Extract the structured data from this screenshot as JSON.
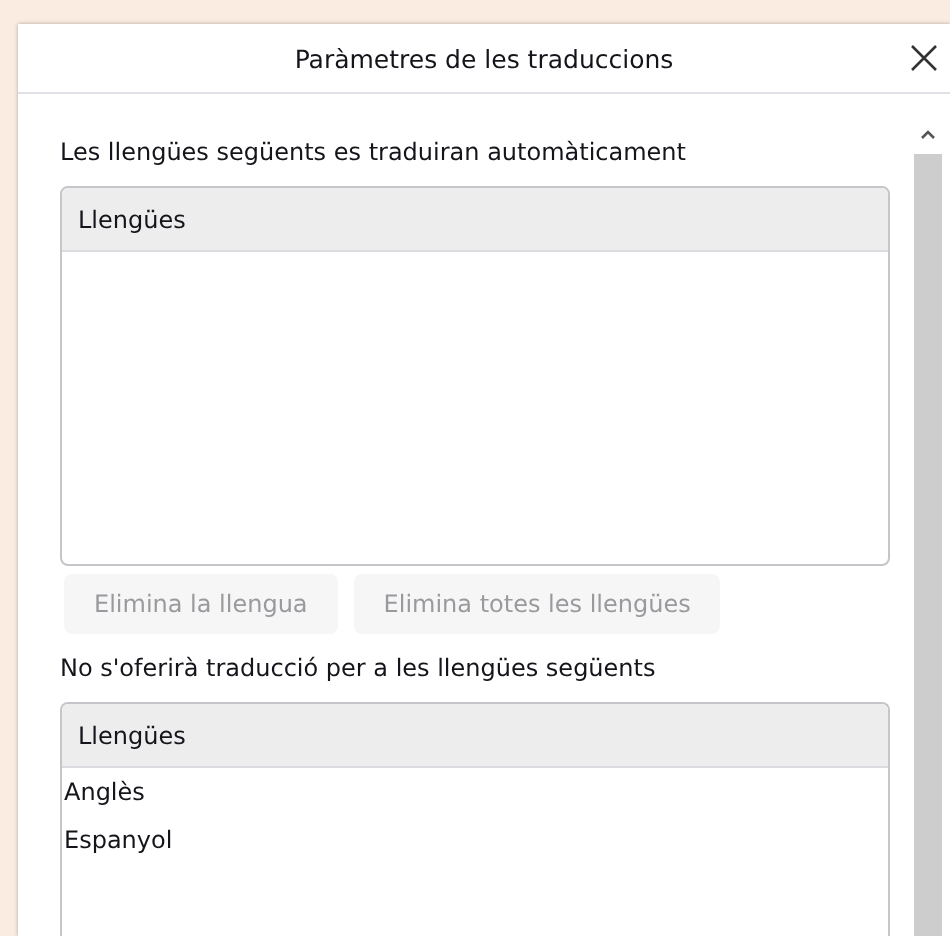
{
  "dialog": {
    "title": "Paràmetres de les traduccions"
  },
  "always_translate": {
    "label": "Les llengües següents es traduiran automàticament",
    "column": "Llengües"
  },
  "buttons": [
    {
      "label": "Elimina la llengua",
      "disabled": true
    },
    {
      "label": "Elimina totes les llengües",
      "disabled": true
    }
  ],
  "never_translate": {
    "label": "No s'oferirà traducció per a les llengües següents",
    "column": "Llengües",
    "items": [
      {
        "label": "Anglès",
        "selected": false
      },
      {
        "label": "Espanyol",
        "selected": false
      }
    ]
  }
}
